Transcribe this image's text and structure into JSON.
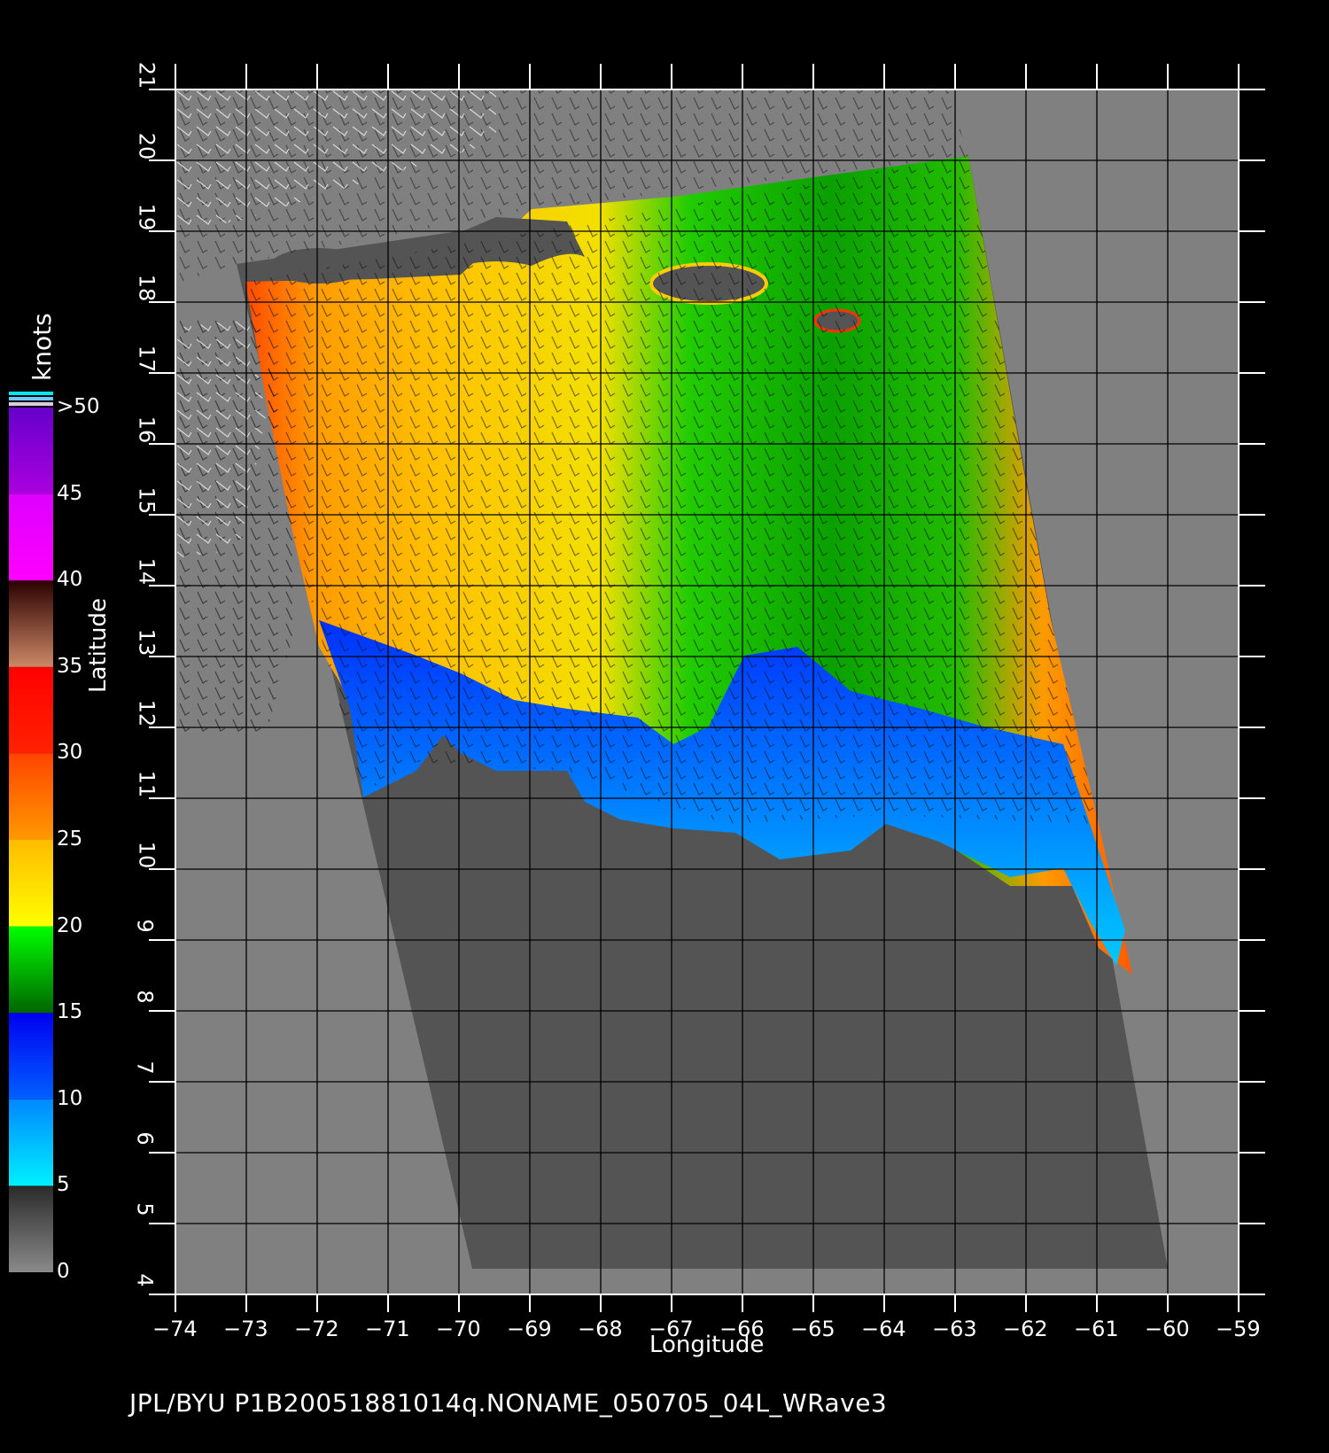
{
  "map": {
    "x_axis_title": "Longitude",
    "y_axis_title": "Latitude",
    "x_ticks": [
      "−74",
      "−73",
      "−72",
      "−71",
      "−70",
      "−69",
      "−68",
      "−67",
      "−66",
      "−65",
      "−64",
      "−63",
      "−62",
      "−61",
      "−60",
      "−59"
    ],
    "y_ticks": [
      "4",
      "5",
      "6",
      "7",
      "8",
      "9",
      "10",
      "11",
      "12",
      "13",
      "14",
      "15",
      "16",
      "17",
      "18",
      "19",
      "20",
      "21"
    ],
    "lon_range": [
      -74,
      -59
    ],
    "lat_range": [
      4,
      21
    ],
    "background_color": "#808080",
    "land_color": "#555555"
  },
  "colorbar": {
    "unit": "knots",
    "labels": [
      "0",
      "5",
      "10",
      "15",
      "20",
      "25",
      "30",
      "35",
      "40",
      "45",
      ">50"
    ],
    "stops": [
      {
        "from": 0,
        "to": 5,
        "colors": [
          "#8a8a8a",
          "#2a2a2a"
        ]
      },
      {
        "from": 5,
        "to": 10,
        "colors": [
          "#00f0ff",
          "#0088ff"
        ]
      },
      {
        "from": 10,
        "to": 15,
        "colors": [
          "#0060ff",
          "#0000f0"
        ]
      },
      {
        "from": 15,
        "to": 20,
        "colors": [
          "#006600",
          "#00ff00"
        ]
      },
      {
        "from": 20,
        "to": 25,
        "colors": [
          "#ffff00",
          "#ffbb00"
        ]
      },
      {
        "from": 25,
        "to": 30,
        "colors": [
          "#ff9900",
          "#ff4400"
        ]
      },
      {
        "from": 30,
        "to": 35,
        "colors": [
          "#ff2200",
          "#ff0000"
        ]
      },
      {
        "from": 35,
        "to": 40,
        "colors": [
          "#cc8866",
          "#2a0000"
        ]
      },
      {
        "from": 40,
        "to": 45,
        "colors": [
          "#ff00ff",
          "#dd00ff"
        ]
      },
      {
        "from": 45,
        "to": 50,
        "colors": [
          "#aa00dd",
          "#6600cc"
        ]
      }
    ]
  },
  "footer": "JPL/BYU  P1B20051881014q.NONAME_050705_04L_WRave3"
}
